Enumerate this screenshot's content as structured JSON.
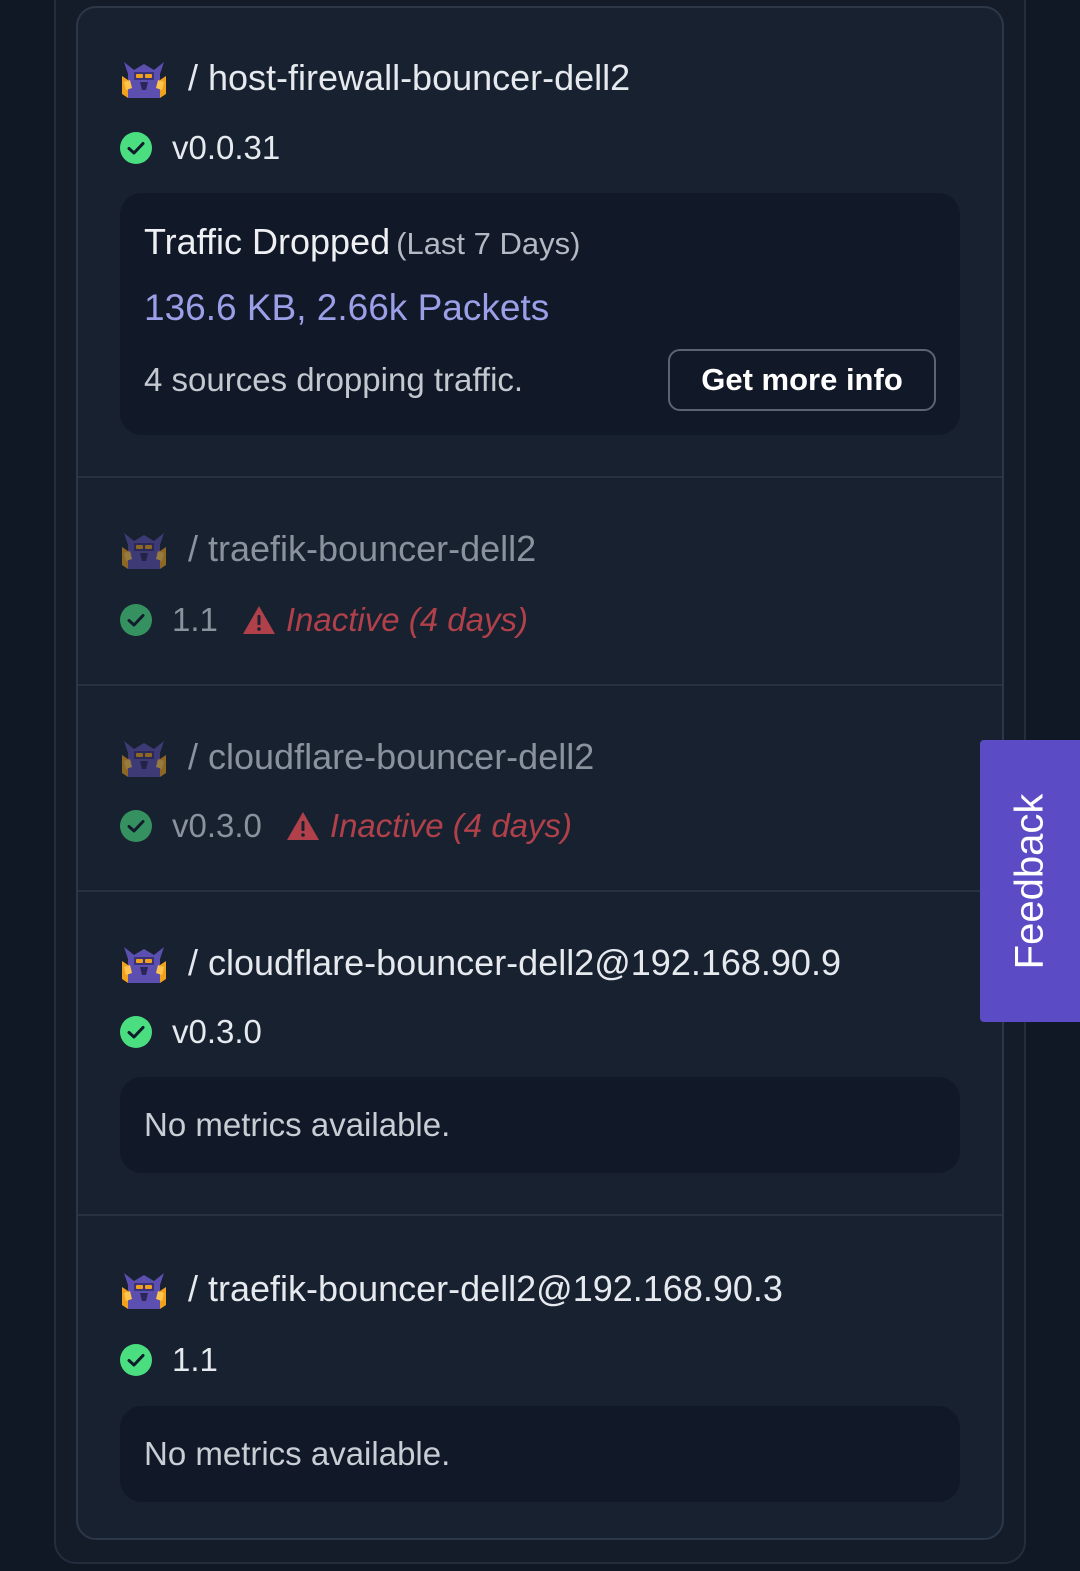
{
  "bouncers": [
    {
      "title": "/ host-firewall-bouncer-dell2",
      "version": "v0.0.31",
      "metrics": {
        "label": "Traffic Dropped",
        "period": "(Last 7 Days)",
        "value": "136.6 KB, 2.66k Packets",
        "sources": "4 sources dropping traffic.",
        "button": "Get more info"
      }
    },
    {
      "title": "/ traefik-bouncer-dell2",
      "version": "1.1",
      "warning": "Inactive (4 days)"
    },
    {
      "title": "/ cloudflare-bouncer-dell2",
      "version": "v0.3.0",
      "warning": "Inactive (4 days)"
    },
    {
      "title": "/ cloudflare-bouncer-dell2@192.168.90.9",
      "version": "v0.3.0",
      "no_metrics": "No metrics available."
    },
    {
      "title": "/ traefik-bouncer-dell2@192.168.90.3",
      "version": "1.1",
      "no_metrics": "No metrics available."
    }
  ],
  "feedback_label": "Feedback",
  "icons": {
    "mascot": "crowdsec-mascot-icon",
    "ok": "check-circle-icon",
    "warning": "warning-triangle-icon"
  },
  "colors": {
    "ok": "#4ade80",
    "warning": "#b0404a",
    "accent": "#5b4bc4",
    "metric_value": "#9a9fe8"
  }
}
